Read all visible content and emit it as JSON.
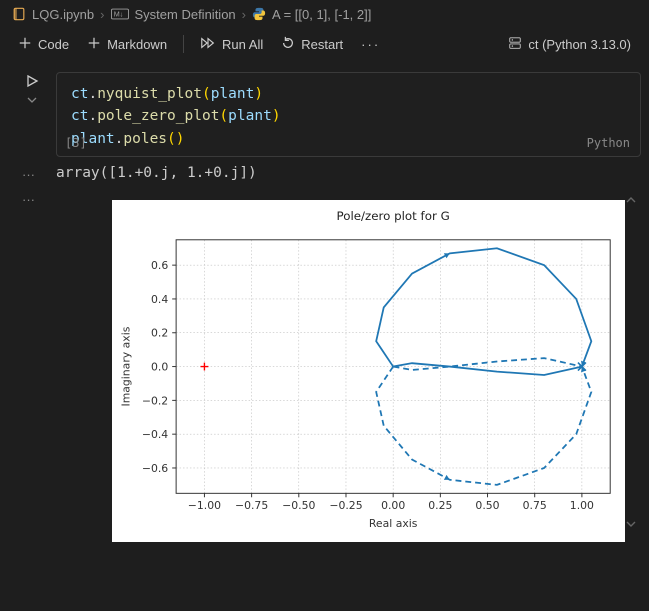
{
  "breadcrumb": {
    "file": "LQG.ipynb",
    "section": "System Definition",
    "cell": "A = [[0, 1], [-1, 2]]"
  },
  "toolbar": {
    "code": "Code",
    "markdown": "Markdown",
    "runall": "Run All",
    "restart": "Restart",
    "kernel": "ct (Python 3.13.0)"
  },
  "cell": {
    "exec_label": "[3]",
    "lang": "Python",
    "lines": [
      "ct.nyquist_plot(plant)",
      "ct.pole_zero_plot(plant)",
      "plant.poles()"
    ]
  },
  "output": {
    "text": "array([1.+0.j, 1.+0.j])"
  },
  "chart_data": {
    "type": "line",
    "title": "Pole/zero plot for G",
    "xlabel": "Real axis",
    "ylabel": "Imaginary axis",
    "xlim": [
      -1.15,
      1.15
    ],
    "ylim": [
      -0.75,
      0.75
    ],
    "xticks": [
      -1.0,
      -0.75,
      -0.5,
      -0.25,
      0.0,
      0.25,
      0.5,
      0.75,
      1.0
    ],
    "yticks": [
      -0.6,
      -0.4,
      -0.2,
      0.0,
      0.2,
      0.4,
      0.6
    ],
    "grid": true,
    "series": [
      {
        "name": "nyquist-pos",
        "style": "solid",
        "color": "#1f77b4",
        "x": [
          0.0,
          -0.09,
          -0.05,
          0.1,
          0.3,
          0.55,
          0.8,
          0.97,
          1.05,
          1.0,
          0.8,
          0.55,
          0.3,
          0.1,
          0.0
        ],
        "y": [
          0.0,
          0.15,
          0.35,
          0.55,
          0.67,
          0.7,
          0.6,
          0.4,
          0.15,
          0.0,
          -0.05,
          -0.03,
          0.0,
          0.02,
          0.0
        ]
      },
      {
        "name": "nyquist-neg",
        "style": "dashed",
        "color": "#1f77b4",
        "x": [
          0.0,
          -0.09,
          -0.05,
          0.1,
          0.3,
          0.55,
          0.8,
          0.97,
          1.05,
          1.0,
          0.8,
          0.55,
          0.3,
          0.1,
          0.0
        ],
        "y": [
          0.0,
          -0.15,
          -0.35,
          -0.55,
          -0.67,
          -0.7,
          -0.6,
          -0.4,
          -0.15,
          0.0,
          0.05,
          0.03,
          0.0,
          -0.02,
          0.0
        ]
      }
    ],
    "markers": [
      {
        "name": "pole",
        "shape": "x",
        "color": "#1f77b4",
        "x": 1.0,
        "y": 0.0
      },
      {
        "name": "zero",
        "shape": "+",
        "color": "#ff0000",
        "x": -1.0,
        "y": 0.0
      }
    ],
    "arrows": [
      {
        "series": "nyquist-pos",
        "at": 0.25
      },
      {
        "series": "nyquist-pos",
        "at": 0.65
      },
      {
        "series": "nyquist-neg",
        "at": 0.25
      },
      {
        "series": "nyquist-neg",
        "at": 0.65
      }
    ]
  }
}
